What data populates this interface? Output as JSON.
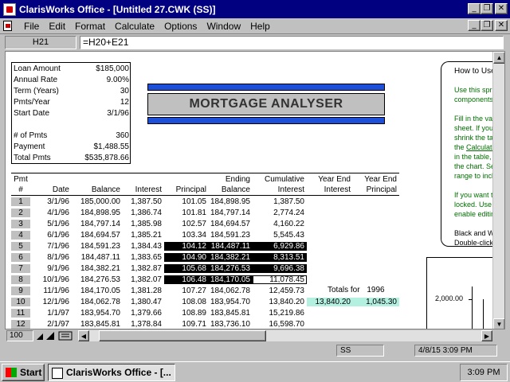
{
  "window": {
    "title": "ClarisWorks Office - [Untitled 27.CWK (SS)]",
    "min": "_",
    "restore": "❐",
    "close": "✕"
  },
  "menu": [
    "File",
    "Edit",
    "Format",
    "Calculate",
    "Options",
    "Window",
    "Help"
  ],
  "formula": {
    "cell": "H21",
    "value": "=H20+E21"
  },
  "summary": {
    "rows": [
      {
        "label": "Loan Amount",
        "value": "$185,000"
      },
      {
        "label": "Annual Rate",
        "value": "9.00%"
      },
      {
        "label": "Term (Years)",
        "value": "30"
      },
      {
        "label": "Pmts/Year",
        "value": "12"
      },
      {
        "label": "Start Date",
        "value": "3/1/96"
      },
      {
        "label": "",
        "value": ""
      },
      {
        "label": "# of Pmts",
        "value": "360"
      },
      {
        "label": "Payment",
        "value": "$1,488.55"
      },
      {
        "label": "Total Pmts",
        "value": "$535,878.66"
      }
    ]
  },
  "banner": "MORTGAGE ANALYSER",
  "help": {
    "title": "How to Use",
    "p1": [
      "Use this spr",
      "components"
    ],
    "p2": [
      "Fill in the va",
      "sheet. If you",
      "shrink the ta",
      "the ",
      "Calculate",
      "in the table,",
      "the chart. Se",
      "range to incl"
    ],
    "p3": [
      "If you want t",
      "locked. Use",
      "enable editin"
    ],
    "p4": [
      "Black and W",
      "Double-click"
    ]
  },
  "chart": {
    "label": "2,000.00"
  },
  "table": {
    "header1": [
      "Pmt",
      "",
      "",
      "",
      "",
      "Ending",
      "Cumulative",
      "Year End",
      "Year End"
    ],
    "header2": [
      "#",
      "Date",
      "Balance",
      "Interest",
      "Principal",
      "Balance",
      "Interest",
      "Interest",
      "Principal"
    ],
    "rows": [
      [
        "1",
        "3/1/96",
        "185,000.00",
        "1,387.50",
        "101.05",
        "184,898.95",
        "1,387.50",
        "",
        ""
      ],
      [
        "2",
        "4/1/96",
        "184,898.95",
        "1,386.74",
        "101.81",
        "184,797.14",
        "2,774.24",
        "",
        ""
      ],
      [
        "3",
        "5/1/96",
        "184,797.14",
        "1,385.98",
        "102.57",
        "184,694.57",
        "4,160.22",
        "",
        ""
      ],
      [
        "4",
        "6/1/96",
        "184,694.57",
        "1,385.21",
        "103.34",
        "184,591.23",
        "5,545.43",
        "",
        ""
      ],
      [
        "5",
        "7/1/96",
        "184,591.23",
        "1,384.43",
        "104.12",
        "184,487.11",
        "6,929.86",
        "",
        ""
      ],
      [
        "6",
        "8/1/96",
        "184,487.11",
        "1,383.65",
        "104.90",
        "184,382.21",
        "8,313.51",
        "",
        ""
      ],
      [
        "7",
        "9/1/96",
        "184,382.21",
        "1,382.87",
        "105.68",
        "184,276.53",
        "9,696.38",
        "",
        ""
      ],
      [
        "8",
        "10/1/96",
        "184,276.53",
        "1,382.07",
        "106.48",
        "184,170.05",
        "11,078.45",
        "",
        ""
      ],
      [
        "9",
        "11/1/96",
        "184,170.05",
        "1,381.28",
        "107.27",
        "184,062.78",
        "12,459.73",
        "",
        ""
      ],
      [
        "10",
        "12/1/96",
        "184,062.78",
        "1,380.47",
        "108.08",
        "183,954.70",
        "13,840.20",
        "13,840.20",
        "1,045.30"
      ],
      [
        "11",
        "1/1/97",
        "183,954.70",
        "1,379.66",
        "108.89",
        "183,845.81",
        "15,219.86",
        "",
        ""
      ],
      [
        "12",
        "2/1/97",
        "183,845.81",
        "1,378.84",
        "109.71",
        "183,736.10",
        "16,598.70",
        "",
        ""
      ]
    ],
    "totals_label": "Totals for",
    "totals_year": "1996"
  },
  "bottom": {
    "zoom": "100"
  },
  "status": {
    "mode": "SS",
    "datetime": "4/8/15 3:09 PM"
  },
  "taskbar": {
    "start": "Start",
    "task": "ClarisWorks Office - [...",
    "clock": "3:09 PM"
  },
  "colors": {
    "title_bg": "#000080",
    "banner_bar": "#1e4fd8",
    "teal": "#b3f0e0",
    "help_text": "#007000"
  }
}
